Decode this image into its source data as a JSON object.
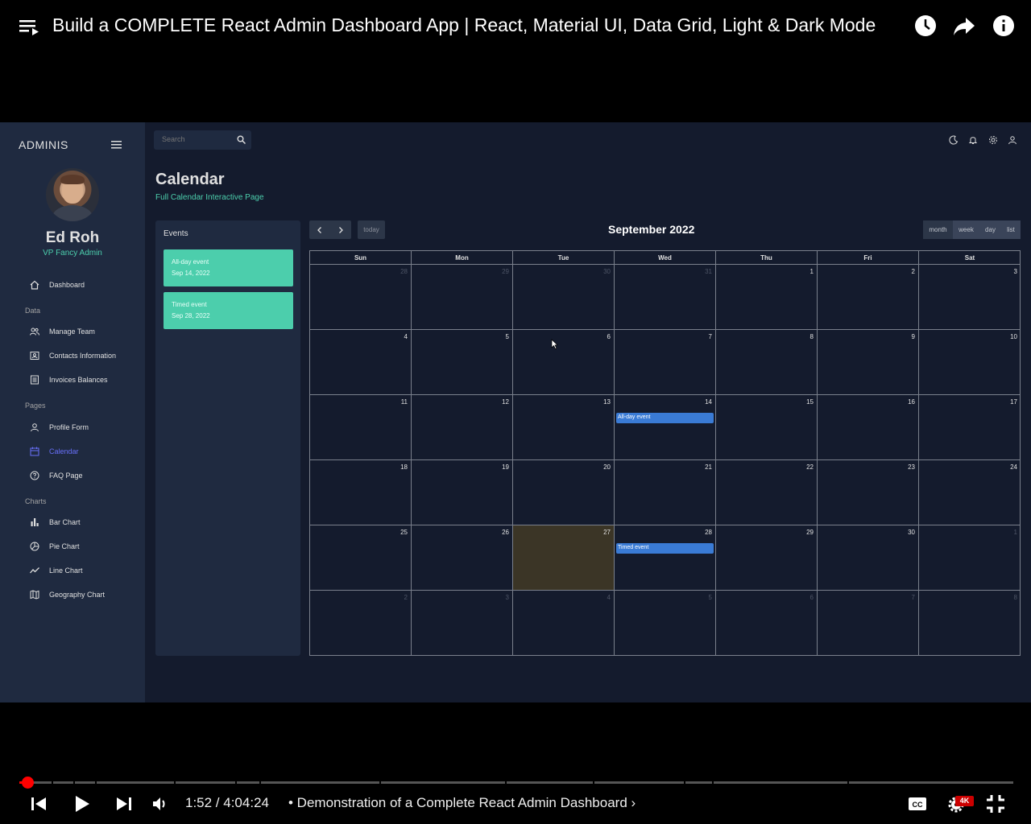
{
  "player": {
    "video_title": "Build a COMPLETE React Admin Dashboard App | React, Material UI, Data Grid, Light & Dark Mode",
    "time_current": "1:52",
    "time_total": "4:04:24",
    "time_display": "1:52 / 4:04:24",
    "chapter_label": "• Demonstration of a Complete React Admin Dashboard",
    "chapter_chevron": "›",
    "progress_fraction": 0.0077,
    "quality_badge": "4K",
    "accent_color": "#ff0000"
  },
  "app": {
    "brand": "ADMINIS",
    "user": {
      "name": "Ed Roh",
      "role": "VP Fancy Admin"
    },
    "search": {
      "placeholder": "Search"
    },
    "sidebar": {
      "dashboard": "Dashboard",
      "section_data": "Data",
      "manage_team": "Manage Team",
      "contacts": "Contacts Information",
      "invoices": "Invoices Balances",
      "section_pages": "Pages",
      "profile_form": "Profile Form",
      "calendar": "Calendar",
      "faq": "FAQ Page",
      "section_charts": "Charts",
      "bar_chart": "Bar Chart",
      "pie_chart": "Pie Chart",
      "line_chart": "Line Chart",
      "geography_chart": "Geography Chart"
    },
    "page": {
      "title": "Calendar",
      "subtitle": "Full Calendar Interactive Page"
    },
    "events_panel": {
      "title": "Events",
      "events": [
        {
          "title": "All-day event",
          "date": "Sep 14, 2022"
        },
        {
          "title": "Timed event",
          "date": "Sep 28, 2022"
        }
      ]
    },
    "calendar": {
      "month_title": "September 2022",
      "today_label": "today",
      "views": {
        "month": "month",
        "week": "week",
        "day": "day",
        "list": "list"
      },
      "active_view": "month",
      "days_of_week": [
        "Sun",
        "Mon",
        "Tue",
        "Wed",
        "Thu",
        "Fri",
        "Sat"
      ],
      "weeks": [
        [
          "28",
          "29",
          "30",
          "31",
          "1",
          "2",
          "3"
        ],
        [
          "4",
          "5",
          "6",
          "7",
          "8",
          "9",
          "10"
        ],
        [
          "11",
          "12",
          "13",
          "14",
          "15",
          "16",
          "17"
        ],
        [
          "18",
          "19",
          "20",
          "21",
          "22",
          "23",
          "24"
        ],
        [
          "25",
          "26",
          "27",
          "28",
          "29",
          "30",
          "1"
        ],
        [
          "2",
          "3",
          "4",
          "5",
          "6",
          "7",
          "8"
        ]
      ],
      "grid_events": [
        {
          "label": "All-day event",
          "date": "14"
        },
        {
          "label": "Timed event",
          "date": "28"
        }
      ],
      "today": "27"
    },
    "colors": {
      "accent_green": "#4cceac",
      "active_nav": "#6870fa",
      "event_blue": "#3a7bd5",
      "bg": "#141b2d",
      "panel": "#1f2a40"
    }
  }
}
